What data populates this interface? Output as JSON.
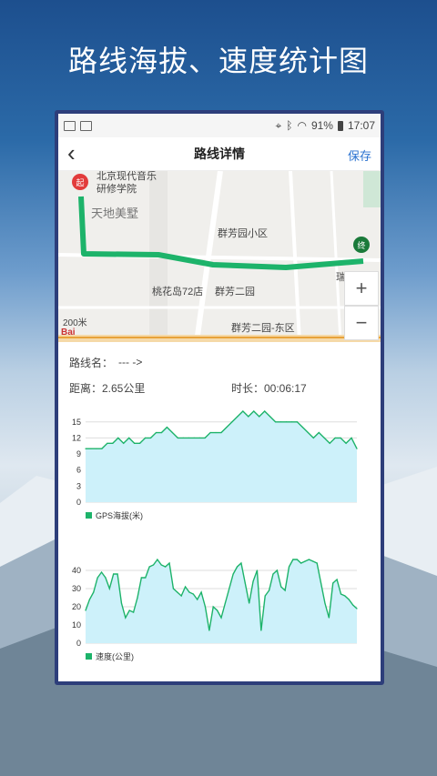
{
  "promo": {
    "title": "路线海拔、速度统计图"
  },
  "status_bar": {
    "battery": "91%",
    "time": "17:07"
  },
  "app_bar": {
    "back_icon": "chevron-left",
    "title": "路线详情",
    "save_label": "保存"
  },
  "map": {
    "labels": {
      "school1": "北京现代音乐",
      "school2": "研修学院",
      "villa": "天地美墅",
      "community1": "群芳园小区",
      "taohua": "桃花岛72店",
      "community2": "群芳二园",
      "community2e": "群芳二园-东区",
      "rui": "瑞",
      "scale": "200米",
      "logo": "Bai"
    },
    "start_marker": "起",
    "end_marker": "终",
    "zoom_in": "+",
    "zoom_out": "−",
    "route_color": "#1db36a"
  },
  "route_info": {
    "name_label": "路线名：",
    "name_value": "--- ->",
    "distance": "距离：2.65公里",
    "duration": "时长：00:06:17"
  },
  "chart_data": [
    {
      "type": "area",
      "legend": "GPS海拔(米)",
      "ylim": [
        0,
        17
      ],
      "yticks": [
        0,
        3,
        6,
        9,
        12,
        15
      ],
      "color": "#1db36a",
      "fill": "#cdf1fa",
      "values": [
        10,
        10,
        10,
        10,
        11,
        11,
        12,
        11,
        12,
        11,
        11,
        12,
        12,
        13,
        13,
        14,
        13,
        12,
        12,
        12,
        12,
        12,
        12,
        13,
        13,
        13,
        14,
        15,
        16,
        17,
        16,
        17,
        16,
        17,
        16,
        15,
        15,
        15,
        15,
        15,
        14,
        13,
        12,
        13,
        12,
        11,
        12,
        12,
        11,
        12,
        10
      ]
    },
    {
      "type": "area",
      "legend": "速度(公里)",
      "ylim": [
        0,
        50
      ],
      "yticks": [
        0,
        10,
        20,
        30,
        40
      ],
      "color": "#1db36a",
      "fill": "#cdf1fa",
      "values": [
        18,
        24,
        28,
        36,
        39,
        36,
        30,
        38,
        38,
        22,
        14,
        18,
        17,
        25,
        36,
        36,
        42,
        43,
        46,
        43,
        42,
        44,
        30,
        28,
        26,
        31,
        28,
        27,
        24,
        28,
        20,
        7,
        20,
        18,
        14,
        22,
        30,
        38,
        42,
        44,
        33,
        22,
        34,
        40,
        7,
        26,
        29,
        38,
        40,
        31,
        29,
        42,
        46,
        46,
        44,
        45,
        46,
        45,
        44,
        33,
        22,
        14,
        33,
        35,
        27,
        26,
        24,
        21,
        19
      ]
    }
  ]
}
